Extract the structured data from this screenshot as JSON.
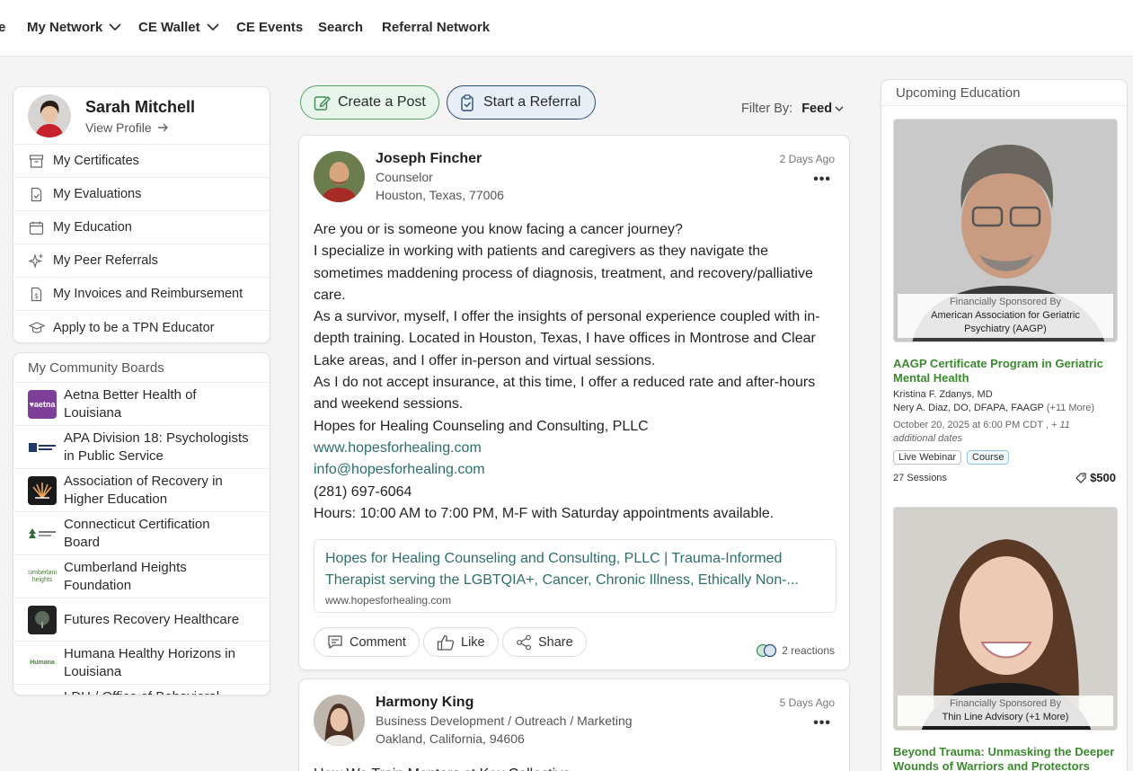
{
  "nav": {
    "items": [
      "e",
      "My Network",
      "CE Wallet",
      "CE Events",
      "Search",
      "Referral Network"
    ]
  },
  "profile": {
    "name": "Sarah Mitchell",
    "view_profile": "View Profile",
    "menu": [
      {
        "label": "My Certificates",
        "icon": "archive-icon"
      },
      {
        "label": "My Evaluations",
        "icon": "document-check-icon"
      },
      {
        "label": "My Education",
        "icon": "calendar-icon"
      },
      {
        "label": "My Peer Referrals",
        "icon": "sparkle-icon"
      },
      {
        "label": "My Invoices and Reimbursement",
        "icon": "invoice-icon"
      },
      {
        "label": "Apply to be a TPN Educator",
        "icon": "graduation-cap-icon"
      }
    ]
  },
  "boards": {
    "title": "My Community Boards",
    "items": [
      {
        "name": "Aetna Better Health of Louisiana",
        "line1": "Aetna Better Health of",
        "line2": "Louisiana",
        "logo_text": "♥aetna",
        "color": "#7d3f98"
      },
      {
        "name": "APA Division 18",
        "line1": "APA Division 18: Psychologists",
        "line2": "in Public Service",
        "logo_text": "",
        "color": "#1f3a66"
      },
      {
        "name": "Association of Recovery",
        "line1": "Association of Recovery in",
        "line2": "Higher Education",
        "logo_text": "",
        "color": "#1a1a1a"
      },
      {
        "name": "Connecticut Certification Board",
        "line1": "Connecticut Certification",
        "line2": "Board",
        "logo_text": "",
        "color": "#2f6b3a"
      },
      {
        "name": "Cumberland Heights Foundation",
        "line1": "Cumberland Heights",
        "line2": "Foundation",
        "logo_text": "cumberland heights",
        "color": "#4a7a3a"
      },
      {
        "name": "Futures Recovery Healthcare",
        "line1": "Futures Recovery Healthcare",
        "line2": "",
        "logo_text": "",
        "color": "#222"
      },
      {
        "name": "Humana Healthy Horizons",
        "line1": "Humana Healthy Horizons in",
        "line2": "Louisiana",
        "logo_text": "Humana",
        "color": "#3a8a2e"
      },
      {
        "name": "LDH",
        "line1": "LDH / Office of Behavioral",
        "line2": "",
        "logo_text": "",
        "color": "#555"
      }
    ]
  },
  "actions": {
    "create_post": "Create a Post",
    "start_referral": "Start a Referral",
    "filter_label": "Filter By:",
    "filter_value": "Feed"
  },
  "post1": {
    "author": "Joseph Fincher",
    "role": "Counselor",
    "location": "Houston, Texas, 77006",
    "date": "2 Days Ago",
    "more": "•••",
    "lines": [
      "Are you or is someone you know facing a cancer journey?",
      "I specialize in working with patients and caregivers as they navigate the",
      "sometimes maddening process of diagnosis, treatment, and recovery/palliative",
      "care.",
      "As a survivor, myself, I offer the insights of personal experience coupled with in-",
      "depth training. Located in Houston, Texas, I have offices in Montrose and Clear",
      "Lake areas, and I offer in-person and virtual sessions.",
      "As I do not accept insurance, at this time, I offer a reduced rate and after-hours",
      "and weekend sessions.",
      "Hopes for Healing Counseling and Consulting, PLLC"
    ],
    "website": "www.hopesforhealing.com",
    "email": "info@hopesforhealing.com",
    "phone": "(281) 697-6064",
    "hours": "Hours: 10:00 AM to 7:00 PM, M-F with Saturday appointments available.",
    "preview_title1": "Hopes for Healing Counseling and Consulting, PLLC | Trauma-Informed",
    "preview_title2": "Therapist serving the LGBTQIA+, Cancer, Chronic Illness, Ethically Non-...",
    "preview_url": "www.hopesforhealing.com",
    "comment": "Comment",
    "like": "Like",
    "share": "Share",
    "reactions": "2 reactions"
  },
  "post2": {
    "author": "Harmony King",
    "role": "Business Development / Outreach / Marketing",
    "location": "Oakland, California, 94606",
    "date": "5 Days Ago",
    "more": "•••",
    "first_line": "How We Train Mentors at Key Collective"
  },
  "education": {
    "title": "Upcoming Education",
    "items": [
      {
        "sponsor_label": "Financially Sponsored By",
        "sponsor": "American Association for Geriatric Psychiatry (AAGP)",
        "sponsor_l1": "American Association for Geriatric",
        "sponsor_l2": "Psychiatry (AAGP)",
        "course_l1": "AAGP Certificate Program in Geriatric",
        "course_l2": "Mental Health",
        "presenter1": "Kristina F. Zdanys, MD",
        "presenter2": "Nery A. Diaz, DO, DFAPA, FAAGP",
        "presenter_more": "(+11 More)",
        "date": "October 20, 2025 at 6:00 PM CDT ,",
        "date_more1": "+ 11",
        "date_more2": "additional dates",
        "tag1": "Live Webinar",
        "tag2": "Course",
        "sessions": "27 Sessions",
        "price": "$500"
      },
      {
        "sponsor_label": "Financially Sponsored By",
        "sponsor": "Thin Line Advisory (+1 More)",
        "course_l1": "Beyond Trauma: Unmasking the Deeper",
        "course_l2": "Wounds of Warriors and Protectors"
      }
    ]
  }
}
